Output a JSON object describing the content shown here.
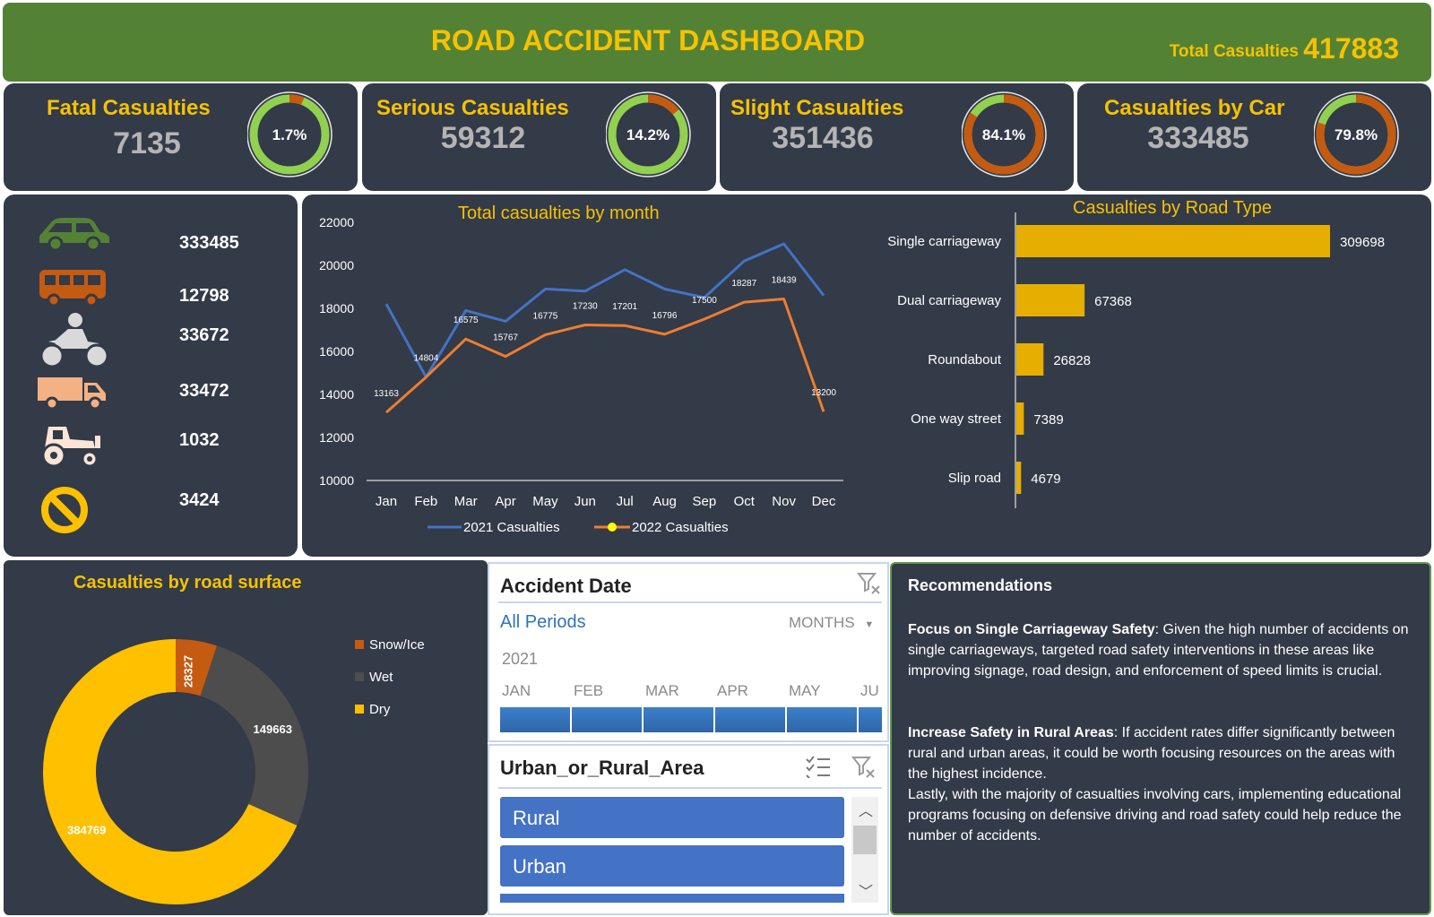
{
  "header": {
    "title": "ROAD ACCIDENT DASHBOARD",
    "total_label": "Total Casualties",
    "total_value": "417883"
  },
  "kpis": [
    {
      "title": "Fatal Casualties",
      "value": "7135",
      "pct_label": "1.7%",
      "pct": 1.7
    },
    {
      "title": "Serious Casualties",
      "value": "59312",
      "pct_label": "14.2%",
      "pct": 14.2
    },
    {
      "title": "Slight Casualties",
      "value": "351436",
      "pct_label": "84.1%",
      "pct": 84.1
    },
    {
      "title": "Casualties by Car",
      "value": "333485",
      "pct_label": "79.8%",
      "pct": 79.8
    }
  ],
  "vehicles": [
    {
      "icon": "car-icon",
      "value": "333485",
      "color": "#548235"
    },
    {
      "icon": "bus-icon",
      "value": "12798",
      "color": "#c55a11"
    },
    {
      "icon": "motorcycle-icon",
      "value": "33672",
      "color": "#d9d9d9"
    },
    {
      "icon": "truck-icon",
      "value": "33472",
      "color": "#f4b183"
    },
    {
      "icon": "tractor-icon",
      "value": "1032",
      "color": "#fbe5d6"
    },
    {
      "icon": "no-entry-icon",
      "value": "3424",
      "color": "#ffc000"
    }
  ],
  "chart_data": [
    {
      "type": "line",
      "title": "Total casualties by month",
      "categories": [
        "Jan",
        "Feb",
        "Mar",
        "Apr",
        "May",
        "Jun",
        "Jul",
        "Aug",
        "Sep",
        "Oct",
        "Nov",
        "Dec"
      ],
      "y_ticks": [
        "22000",
        "20000",
        "18000",
        "16000",
        "14000",
        "12000",
        "10000"
      ],
      "ylim": [
        10000,
        22000
      ],
      "series": [
        {
          "name": "2021 Casualties",
          "color": "#4472c4",
          "values": [
            18200,
            14804,
            17900,
            17400,
            18900,
            18800,
            19800,
            18900,
            18500,
            20200,
            21000,
            18600
          ]
        },
        {
          "name": "2022 Casualties",
          "color": "#ed7d31",
          "values": [
            13163,
            14804,
            16575,
            15767,
            16775,
            17230,
            17201,
            16796,
            17500,
            18287,
            18439,
            13200
          ]
        }
      ],
      "data_labels": [
        "13163",
        "14804",
        "16575",
        "15767",
        "16775",
        "17230",
        "17201",
        "16796",
        "17500",
        "18287",
        "18439",
        "13200"
      ]
    },
    {
      "type": "bar",
      "title": "Casualties by Road Type",
      "categories": [
        "Single carriageway",
        "Dual carriageway",
        "Roundabout",
        "One way street",
        "Slip road"
      ],
      "values": [
        309698,
        67368,
        26828,
        7389,
        4679
      ],
      "value_labels": [
        "309698",
        "67368",
        "26828",
        "7389",
        "4679"
      ],
      "color": "#e6ae00"
    },
    {
      "type": "pie",
      "title": "Casualties by road surface",
      "categories": [
        "Snow/Ice",
        "Wet",
        "Dry"
      ],
      "values": [
        28327,
        149663,
        384769
      ],
      "value_labels": [
        "28327",
        "149663",
        "384769"
      ],
      "colors": [
        "#c55a11",
        "#4d4d4d",
        "#ffc000"
      ]
    }
  ],
  "slicer_date": {
    "title": "Accident Date",
    "period": "All Periods",
    "unit": "MONTHS",
    "year": "2021",
    "months": [
      "JAN",
      "FEB",
      "MAR",
      "APR",
      "MAY",
      "JU"
    ]
  },
  "slicer_area": {
    "title": "Urban_or_Rural_Area",
    "items": [
      "Rural",
      "Urban"
    ]
  },
  "recommendations": {
    "title": "Recommendations",
    "p1_bold": "Focus on Single Carriageway Safety",
    "p1_text": ": Given the high number of accidents on single carriageways, targeted road safety interventions in these areas like improving signage, road design, and enforcement of speed limits is crucial.",
    "p2_bold": "Increase Safety in Rural Areas",
    "p2_text": ": If accident rates differ significantly between rural and urban areas, it could be worth focusing resources on the areas with the highest incidence.",
    "p3_text": "Lastly, with the majority of casualties involving cars, implementing educational programs focusing on defensive driving and road safety could help reduce the number of accidents."
  }
}
